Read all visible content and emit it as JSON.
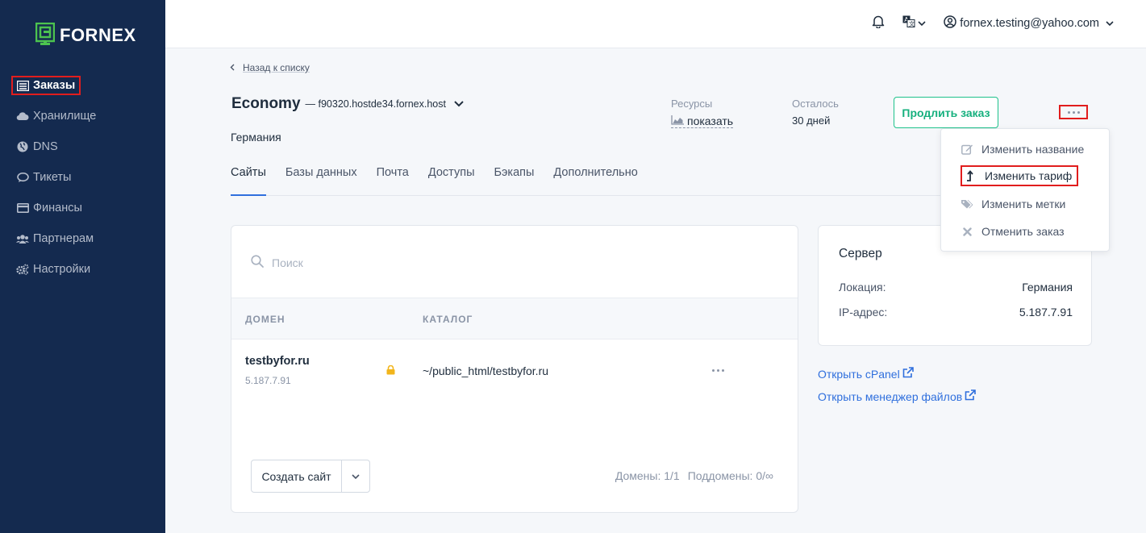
{
  "brand": {
    "name": "FORNEX",
    "accent": "#4cc34f",
    "sidebar_bg": "#142a4f"
  },
  "sidebar": {
    "items": [
      {
        "label": "Заказы",
        "icon": "server-list-icon",
        "active": true
      },
      {
        "label": "Хранилище",
        "icon": "cloud-icon"
      },
      {
        "label": "DNS",
        "icon": "globe-icon"
      },
      {
        "label": "Тикеты",
        "icon": "chat-icon"
      },
      {
        "label": "Финансы",
        "icon": "credit-card-icon"
      },
      {
        "label": "Партнерам",
        "icon": "users-icon"
      },
      {
        "label": "Настройки",
        "icon": "cogs-icon"
      }
    ]
  },
  "topbar": {
    "user_email": "fornex.testing@yahoo.com",
    "icons": [
      "bell-icon",
      "language-icon",
      "user-circle-icon"
    ]
  },
  "header": {
    "back_label": "Назад к списку",
    "order_name": "Economy",
    "order_host": "— f90320.hostde34.fornex.host",
    "country": "Германия",
    "resources_label": "Ресурсы",
    "resources_value": "показать",
    "remaining_label": "Осталось",
    "remaining_value": "30 дней",
    "extend_button": "Продлить заказ"
  },
  "menu": {
    "items": [
      {
        "label": "Изменить название",
        "icon": "edit-icon"
      },
      {
        "label": "Изменить тариф",
        "icon": "upgrade-arrow-icon",
        "highlighted": true
      },
      {
        "label": "Изменить метки",
        "icon": "tags-icon"
      },
      {
        "label": "Отменить заказ",
        "icon": "close-icon"
      }
    ]
  },
  "tabs": [
    {
      "label": "Сайты",
      "active": true
    },
    {
      "label": "Базы данных"
    },
    {
      "label": "Почта"
    },
    {
      "label": "Доступы"
    },
    {
      "label": "Бэкапы"
    },
    {
      "label": "Дополнительно"
    }
  ],
  "sites": {
    "search_placeholder": "Поиск",
    "columns": [
      "ДОМЕН",
      "КАТАЛОГ"
    ],
    "rows": [
      {
        "domain": "testbyfor.ru",
        "ip": "5.187.7.91",
        "path": "~/public_html/testbyfor.ru"
      }
    ],
    "create_button": "Создать сайт",
    "domains_count": "Домены: 1/1",
    "subdomains_count": "Поддомены: 0/∞"
  },
  "server": {
    "title": "Сервер",
    "location_label": "Локация:",
    "location_value": "Германия",
    "ip_label": "IP-адрес:",
    "ip_value": "5.187.7.91"
  },
  "links": {
    "cpanel": "Открыть cPanel",
    "file_manager": "Открыть менеджер файлов"
  }
}
